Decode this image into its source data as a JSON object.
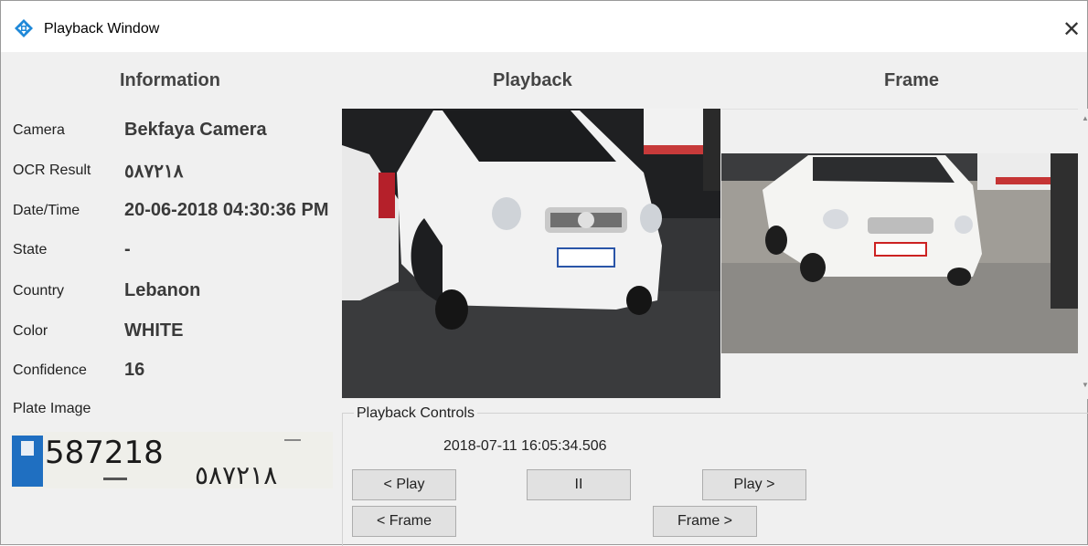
{
  "window": {
    "title": "Playback Window",
    "close_symbol": "✕"
  },
  "headers": {
    "information": "Information",
    "playback": "Playback",
    "frame": "Frame"
  },
  "info": {
    "camera": {
      "label": "Camera",
      "value": "Bekfaya Camera"
    },
    "ocr": {
      "label": "OCR Result",
      "value": "٥٨٧٢١٨"
    },
    "datetime": {
      "label": "Date/Time",
      "value": "20-06-2018 04:30:36 PM"
    },
    "state": {
      "label": "State",
      "value": "-"
    },
    "country": {
      "label": "Country",
      "value": "Lebanon"
    },
    "color": {
      "label": "Color",
      "value": "WHITE"
    },
    "confidence": {
      "label": "Confidence",
      "value": "16"
    },
    "plate_image": {
      "label": "Plate Image",
      "plate_number": "587218",
      "plate_arabic": "٥٨٧٢١٨"
    }
  },
  "controls": {
    "legend": "Playback Controls",
    "timestamp": "2018-07-11 16:05:34.506",
    "play_back": "< Play",
    "pause": "II",
    "play_forward": "Play >",
    "frame_back": "< Frame",
    "frame_forward": "Frame >"
  },
  "icons": {
    "app": "diamond-arrows-icon",
    "close": "close-icon"
  },
  "colors": {
    "app_icon": "#1e88d8",
    "window_bg": "#f0f0f0",
    "button_bg": "#e1e1e1"
  }
}
